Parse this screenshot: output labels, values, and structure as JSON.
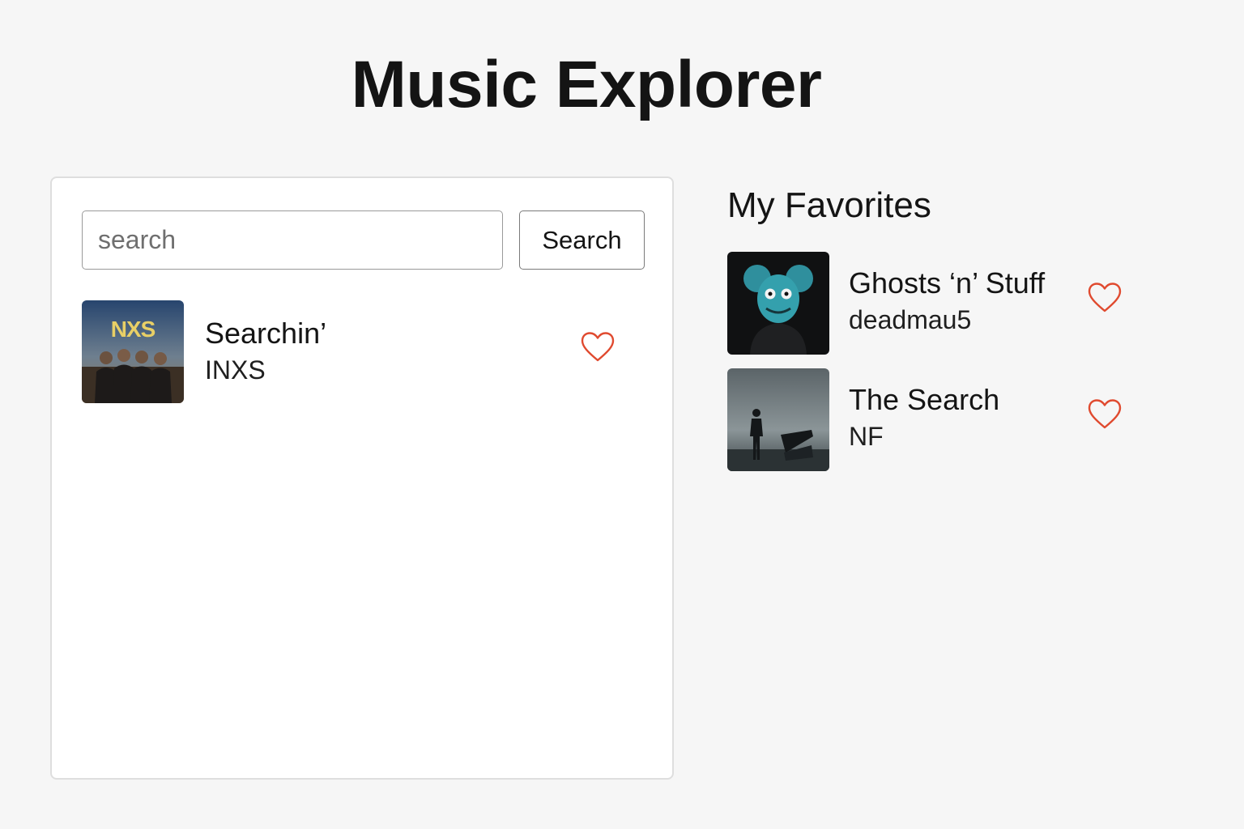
{
  "app": {
    "title": "Music Explorer"
  },
  "search": {
    "placeholder": "search",
    "value": "",
    "button_label": "Search"
  },
  "results": [
    {
      "title": "Searchin’",
      "artist": "INXS",
      "cover_text": "NXS",
      "favorited": false
    }
  ],
  "favorites": {
    "heading": "My Favorites",
    "items": [
      {
        "title": "Ghosts ‘n’ Stuff",
        "artist": "deadmau5",
        "favorited": true
      },
      {
        "title": "The Search",
        "artist": "NF",
        "favorited": true
      }
    ]
  },
  "colors": {
    "background": "#f6f6f6",
    "panel": "#ffffff",
    "heart": "#e04a2f",
    "text": "#141414"
  },
  "icons": {
    "favorite": "heart-outline-icon"
  }
}
